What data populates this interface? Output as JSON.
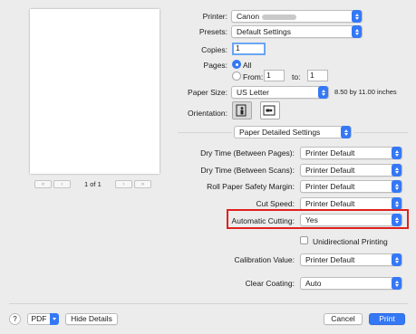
{
  "preview": {
    "page_indicator": "1 of 1",
    "first_label": "«",
    "prev_label": "‹",
    "next_label": "›",
    "last_label": "»"
  },
  "printer": {
    "label": "Printer:",
    "value": "Canon"
  },
  "presets": {
    "label": "Presets:",
    "value": "Default Settings"
  },
  "copies": {
    "label": "Copies:",
    "value": "1"
  },
  "pages": {
    "label": "Pages:",
    "all_label": "All",
    "from_label": "From:",
    "from_value": "1",
    "to_label": "to:",
    "to_value": "1",
    "selected": "All"
  },
  "paper_size": {
    "label": "Paper Size:",
    "value": "US Letter",
    "dimensions": "8.50 by 11.00 inches"
  },
  "orientation": {
    "label": "Orientation:",
    "selected": "portrait"
  },
  "section": {
    "value": "Paper Detailed Settings"
  },
  "settings": {
    "dry_time_pages": {
      "label": "Dry Time (Between Pages):",
      "value": "Printer Default"
    },
    "dry_time_scans": {
      "label": "Dry Time (Between Scans):",
      "value": "Printer Default"
    },
    "roll_margin": {
      "label": "Roll Paper Safety Margin:",
      "value": "Printer Default"
    },
    "cut_speed": {
      "label": "Cut Speed:",
      "value": "Printer Default"
    },
    "auto_cutting": {
      "label": "Automatic Cutting:",
      "value": "Yes"
    },
    "unidirectional": {
      "label": "Unidirectional Printing",
      "checked": false
    },
    "calibration": {
      "label": "Calibration Value:",
      "value": "Printer Default"
    },
    "clear_coating": {
      "label": "Clear Coating:",
      "value": "Auto"
    }
  },
  "footer": {
    "help_label": "?",
    "pdf_label": "PDF",
    "hide_details_label": "Hide Details",
    "cancel_label": "Cancel",
    "print_label": "Print"
  },
  "colors": {
    "accent": "#3478f6",
    "highlight": "#e0211d",
    "background": "#ececec"
  }
}
